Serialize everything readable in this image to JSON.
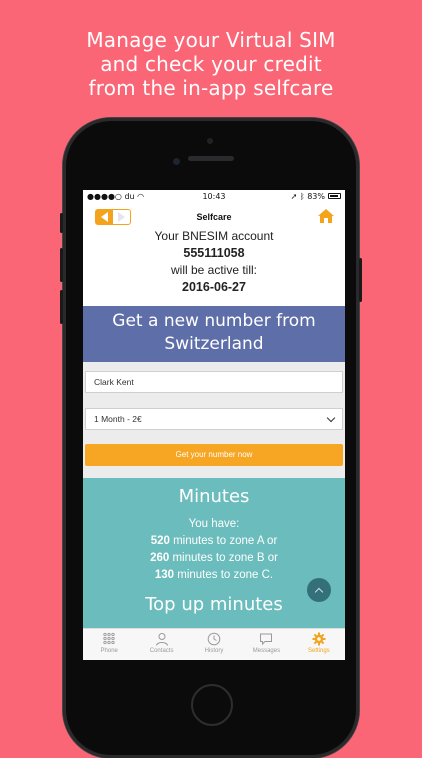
{
  "promo": {
    "line1": "Manage your Virtual SIM",
    "line2": "and check your credit",
    "line3": "from the in-app selfcare"
  },
  "status_bar": {
    "carrier": "du",
    "time": "10:43",
    "battery": "83%"
  },
  "nav": {
    "title": "Selfcare"
  },
  "account": {
    "line1": "Your BNESIM account",
    "number": "555111058",
    "line2": "will be active till:",
    "date": "2016-06-27"
  },
  "new_number": {
    "heading_line1": "Get a new number from",
    "heading_line2": "Switzerland",
    "name_value": "Clark Kent",
    "plan_selected": "1 Month - 2€",
    "cta_label": "Get your number now"
  },
  "minutes": {
    "heading": "Minutes",
    "intro": "You have:",
    "rows": [
      {
        "count": "520",
        "text": " minutes to zone A or"
      },
      {
        "count": "260",
        "text": " minutes to zone B or"
      },
      {
        "count": "130",
        "text": " minutes to zone C."
      }
    ],
    "topup_heading": "Top up minutes"
  },
  "tabs": [
    {
      "label": "Phone",
      "icon": "dialpad-icon"
    },
    {
      "label": "Contacts",
      "icon": "contacts-icon"
    },
    {
      "label": "History",
      "icon": "clock-icon"
    },
    {
      "label": "Messages",
      "icon": "chat-bubble-icon"
    },
    {
      "label": "Settings",
      "icon": "gear-icon",
      "active": true
    }
  ],
  "colors": {
    "background": "#fb6676",
    "accent": "#f4a31c",
    "blue_panel": "#5d6ea8",
    "teal_panel": "#6bbcbc"
  }
}
